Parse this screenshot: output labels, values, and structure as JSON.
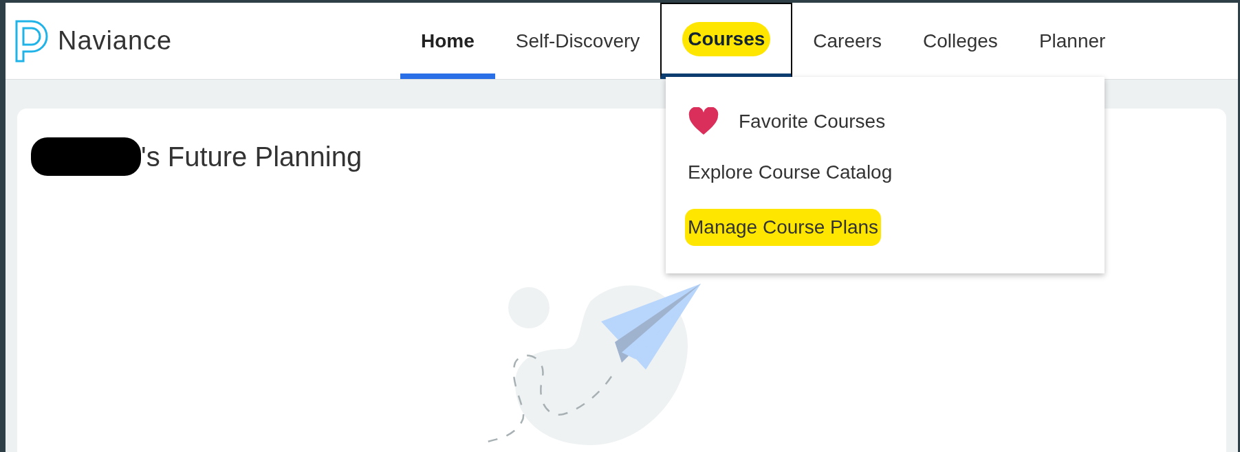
{
  "brand": {
    "name": "Naviance"
  },
  "nav": [
    {
      "label": "Home",
      "selected": true,
      "highlighted": false,
      "expanded": false
    },
    {
      "label": "Self-Discovery",
      "selected": false,
      "highlighted": false,
      "expanded": false
    },
    {
      "label": "Courses",
      "selected": false,
      "highlighted": true,
      "expanded": true
    },
    {
      "label": "Careers",
      "selected": false,
      "highlighted": false,
      "expanded": false
    },
    {
      "label": "Colleges",
      "selected": false,
      "highlighted": false,
      "expanded": false
    },
    {
      "label": "Planner",
      "selected": false,
      "highlighted": false,
      "expanded": false
    }
  ],
  "menu": [
    {
      "kind": "favorite",
      "label": "Favorite Courses",
      "highlighted": false
    },
    {
      "kind": "plain",
      "label": "Explore Course Catalog",
      "highlighted": false
    },
    {
      "kind": "plain",
      "label": "Manage Course Plans",
      "highlighted": true
    }
  ],
  "card": {
    "title": "'s Future Planning",
    "name_redacted": true
  }
}
